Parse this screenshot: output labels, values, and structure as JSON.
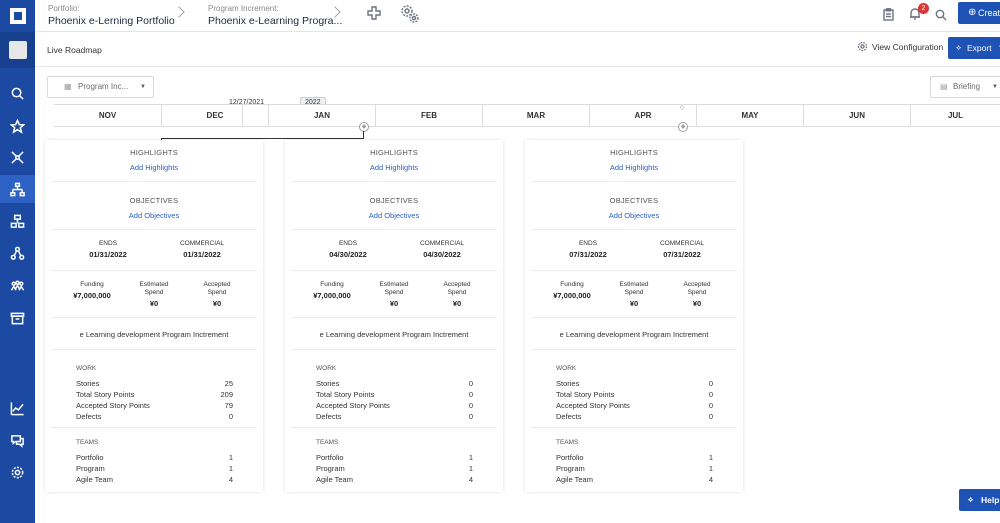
{
  "header": {
    "portfolio_label": "Portfolio:",
    "portfolio_value": "Phoenix e-Lerning Portfolio",
    "pi_label": "Program Increment:",
    "pi_value": "Phoenix e-Learning Progra...",
    "notification_count": "2",
    "create_label": "Create"
  },
  "subheader": {
    "page_title": "Live Roadmap",
    "view_config_label": "View Configuration",
    "export_label": "Export"
  },
  "toolbar": {
    "pi_select_value": "Program Inc...",
    "briefing_value": "Briefing"
  },
  "timeline": {
    "date_marker": "12/27/2021",
    "year_chip": "2022",
    "months": [
      "NOV",
      "DEC",
      "JAN",
      "FEB",
      "MAR",
      "APR",
      "MAY",
      "JUN",
      "JUL"
    ]
  },
  "labels": {
    "highlights": "HIGHLIGHTS",
    "add_highlights": "Add Highlights",
    "objectives": "OBJECTIVES",
    "add_objectives": "Add Objectives",
    "ends": "ENDS",
    "commercial": "COMMERCIAL",
    "funding": "Funding",
    "estimated_spend": "Estimated Spend",
    "accepted_spend": "Accepted Spend",
    "work": "WORK",
    "stories": "Stories",
    "total_story_points": "Total Story Points",
    "accepted_story_points": "Accepted Story Points",
    "defects": "Defects",
    "teams": "TEAMS",
    "portfolio": "Portfolio",
    "program": "Program",
    "agile_team": "Agile Team"
  },
  "cards": [
    {
      "ends": "01/31/2022",
      "commercial": "01/31/2022",
      "funding": "¥7,000,000",
      "estimated_spend": "¥0",
      "accepted_spend": "¥0",
      "description": "e Learning development Program Inctrement",
      "stories": "25",
      "total_story_points": "209",
      "accepted_story_points": "79",
      "defects": "0",
      "portfolio": "1",
      "program": "1",
      "agile_team": "4"
    },
    {
      "ends": "04/30/2022",
      "commercial": "04/30/2022",
      "funding": "¥7,000,000",
      "estimated_spend": "¥0",
      "accepted_spend": "¥0",
      "description": "e Learning development Program Inctrement",
      "stories": "0",
      "total_story_points": "0",
      "accepted_story_points": "0",
      "defects": "0",
      "portfolio": "1",
      "program": "1",
      "agile_team": "4"
    },
    {
      "ends": "07/31/2022",
      "commercial": "07/31/2022",
      "funding": "¥7,000,000",
      "estimated_spend": "¥0",
      "accepted_spend": "¥0",
      "description": "e Learning development Program Inctrement",
      "stories": "0",
      "total_story_points": "0",
      "accepted_story_points": "0",
      "defects": "0",
      "portfolio": "1",
      "program": "1",
      "agile_team": "4"
    }
  ],
  "help_label": "Help",
  "colors": {
    "nav": "#1c4aa3",
    "accent": "#1f52b5",
    "link": "#2d61c4"
  }
}
